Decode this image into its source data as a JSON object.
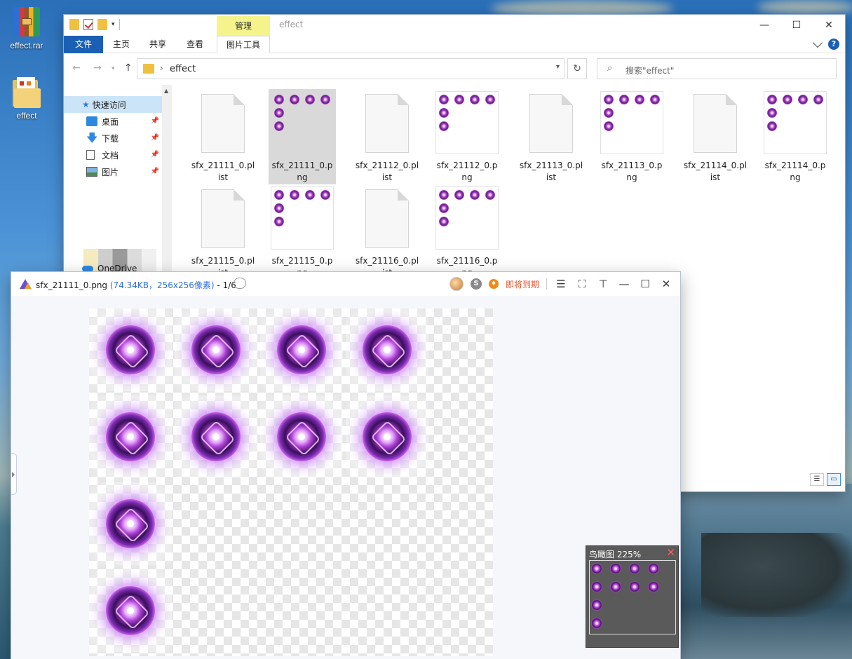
{
  "desktop": {
    "icons": [
      {
        "label": "effect.rar",
        "icon": "winrar-archive-icon"
      },
      {
        "label": "effect",
        "icon": "folder-icon"
      }
    ]
  },
  "explorer": {
    "title": "effect",
    "context_tab": "管理",
    "ribbon_tabs": [
      "文件",
      "主页",
      "共享",
      "查看",
      "图片工具"
    ],
    "address": {
      "crumb": "effect"
    },
    "search_placeholder": "搜索\"effect\"",
    "nav": {
      "quick_access": "快速访问",
      "items": [
        "桌面",
        "下载",
        "文档",
        "图片"
      ],
      "onedrive": "OneDrive"
    },
    "files": [
      {
        "name": "sfx_21111_0.plist",
        "type": "plist",
        "selected": false
      },
      {
        "name": "sfx_21111_0.png",
        "type": "png",
        "selected": true,
        "frames": 6
      },
      {
        "name": "sfx_21112_0.plist",
        "type": "plist",
        "selected": false
      },
      {
        "name": "sfx_21112_0.png",
        "type": "png",
        "selected": false,
        "frames": 6
      },
      {
        "name": "sfx_21113_0.plist",
        "type": "plist",
        "selected": false
      },
      {
        "name": "sfx_21113_0.png",
        "type": "png",
        "selected": false,
        "frames": 6
      },
      {
        "name": "sfx_21114_0.plist",
        "type": "plist",
        "selected": false
      },
      {
        "name": "sfx_21114_0.png",
        "type": "png",
        "selected": false,
        "frames": 6
      },
      {
        "name": "sfx_21115_0.plist",
        "type": "plist",
        "selected": false
      },
      {
        "name": "sfx_21115_0.png",
        "type": "png",
        "selected": false,
        "frames": 6
      },
      {
        "name": "sfx_21116_0.plist",
        "type": "plist",
        "selected": false
      },
      {
        "name": "sfx_21116_0.png",
        "type": "png",
        "selected": false,
        "frames": 6
      }
    ]
  },
  "viewer": {
    "filename": "sfx_21111_0.png",
    "meta": "(74.34KB，256x256像素)",
    "position": "- 1/6",
    "expiry_label": "即将到期",
    "birdseye": {
      "title": "鸟瞰图 225%"
    },
    "sprite_frames": 10
  },
  "colors": {
    "accent": "#1a5fb4",
    "context_tab": "#f4f38c",
    "expiry": "#e2502a"
  }
}
